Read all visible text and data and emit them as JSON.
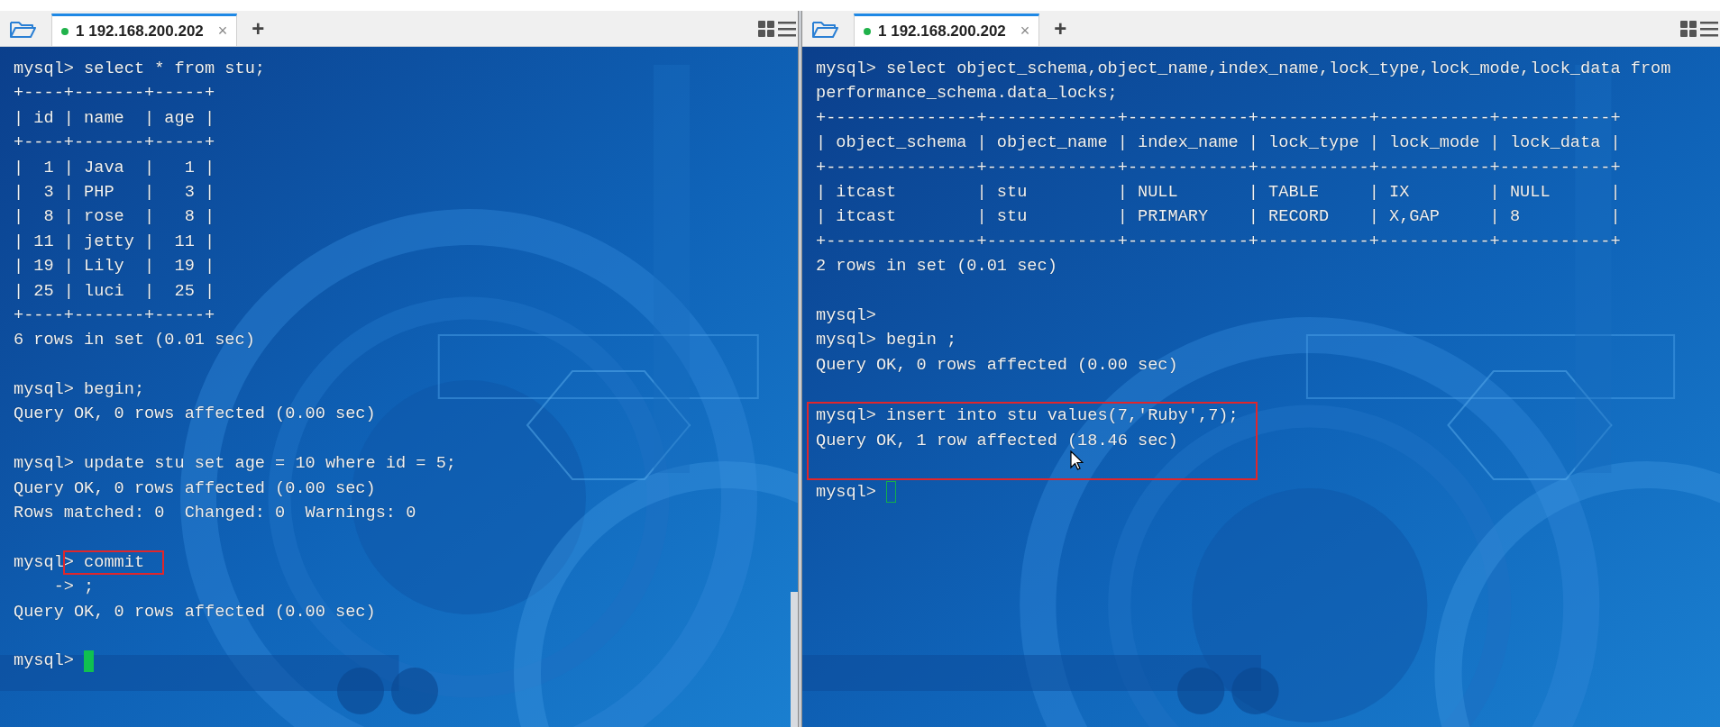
{
  "panes": [
    {
      "tab": {
        "label": "1 192.168.200.202",
        "connected": true,
        "selected": true,
        "close": "×"
      },
      "add": "+",
      "scrollbar": true,
      "lines": [
        {
          "text": "mysql> select * from stu;"
        },
        {
          "text": "+----+-------+-----+"
        },
        {
          "text": "| id | name  | age |"
        },
        {
          "text": "+----+-------+-----+"
        },
        {
          "text": "|  1 | Java  |   1 |"
        },
        {
          "text": "|  3 | PHP   |   3 |"
        },
        {
          "text": "|  8 | rose  |   8 |"
        },
        {
          "text": "| 11 | jetty |  11 |"
        },
        {
          "text": "| 19 | Lily  |  19 |"
        },
        {
          "text": "| 25 | luci  |  25 |"
        },
        {
          "text": "+----+-------+-----+"
        },
        {
          "text": "6 rows in set (0.01 sec)"
        },
        {
          "kind": "blank"
        },
        {
          "text": "mysql> begin;"
        },
        {
          "text": "Query OK, 0 rows affected (0.00 sec)"
        },
        {
          "kind": "blank"
        },
        {
          "text": "mysql> update stu set age = 10 where id = 5;"
        },
        {
          "text": "Query OK, 0 rows affected (0.00 sec)"
        },
        {
          "text": "Rows matched: 0  Changed: 0  Warnings: 0"
        },
        {
          "kind": "blank"
        },
        {
          "text": "mysql> commit",
          "marked": true
        },
        {
          "text": "    -> ;"
        },
        {
          "text": "Query OK, 0 rows affected (0.00 sec)"
        },
        {
          "kind": "blank"
        },
        {
          "kind": "prompt",
          "text": "mysql>",
          "cursor_filled": true
        }
      ]
    },
    {
      "tab": {
        "label": "1 192.168.200.202",
        "connected": true,
        "selected": true,
        "close": "×"
      },
      "add": "+",
      "lines": [
        {
          "text": "mysql> select object_schema,object_name,index_name,lock_type,lock_mode,lock_data from"
        },
        {
          "text": "performance_schema.data_locks;"
        },
        {
          "text": "+---------------+-------------+------------+-----------+-----------+-----------+"
        },
        {
          "text": "| object_schema | object_name | index_name | lock_type | lock_mode | lock_data |"
        },
        {
          "text": "+---------------+-------------+------------+-----------+-----------+-----------+"
        },
        {
          "text": "| itcast        | stu         | NULL       | TABLE     | IX        | NULL      |"
        },
        {
          "text": "| itcast        | stu         | PRIMARY    | RECORD    | X,GAP     | 8         |"
        },
        {
          "text": "+---------------+-------------+------------+-----------+-----------+-----------+"
        },
        {
          "text": "2 rows in set (0.01 sec)"
        },
        {
          "kind": "blank"
        },
        {
          "text": "mysql>"
        },
        {
          "text": "mysql> begin ;"
        },
        {
          "text": "Query OK, 0 rows affected (0.00 sec)"
        },
        {
          "kind": "blank"
        },
        {
          "kind": "boxed",
          "lines": [
            {
              "text": "mysql> insert into stu values(7,'Ruby',7);"
            },
            {
              "text": "Query OK, 1 row affected (18.46 sec)",
              "pointer": true
            }
          ]
        },
        {
          "kind": "prompt",
          "text": "mysql>",
          "cursor_filled": false
        }
      ]
    }
  ]
}
